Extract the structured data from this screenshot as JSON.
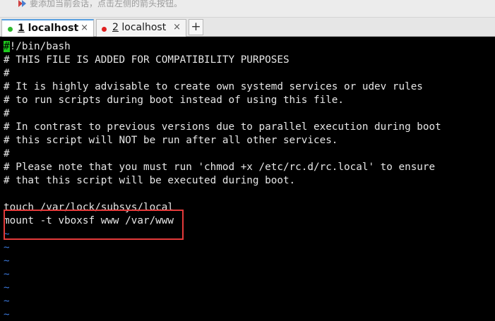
{
  "hint": {
    "icon": "arrow-icon",
    "text": "要添加当前会话，点击左侧的箭头按钮。"
  },
  "tabs": [
    {
      "number": "1",
      "name": "localhost",
      "status_color": "#2eb82e",
      "active": true,
      "close_label": "×"
    },
    {
      "number": "2",
      "name": "localhost",
      "status_color": "#e02020",
      "active": false,
      "close_label": "×"
    }
  ],
  "new_tab_label": "+",
  "terminal": {
    "cursor_char": "#",
    "lines": [
      "!/bin/bash",
      "# THIS FILE IS ADDED FOR COMPATIBILITY PURPOSES",
      "#",
      "# It is highly advisable to create own systemd services or udev rules",
      "# to run scripts during boot instead of using this file.",
      "#",
      "# In contrast to previous versions due to parallel execution during boot",
      "# this script will NOT be run after all other services.",
      "#",
      "# Please note that you must run 'chmod +x /etc/rc.d/rc.local' to ensure",
      "# that this script will be executed during boot.",
      "",
      "touch /var/lock/subsys/local",
      "mount -t vboxsf www /var/www"
    ],
    "tilde": "~",
    "colors": {
      "cursor": "#1ec81e",
      "tilde": "#3a76d8",
      "highlight_border": "#e43a3a"
    }
  }
}
